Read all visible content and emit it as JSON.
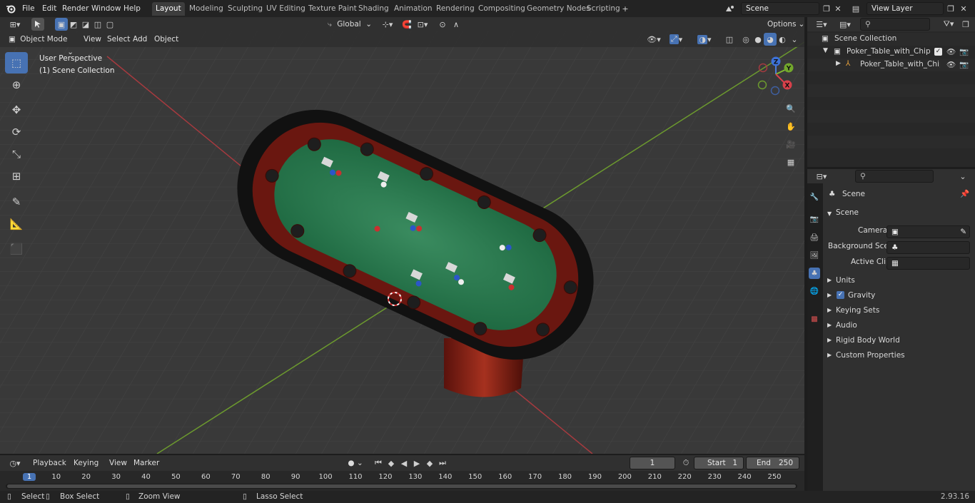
{
  "menu": {
    "file": "File",
    "edit": "Edit",
    "render": "Render",
    "window": "Window",
    "help": "Help"
  },
  "workspaces": [
    "Layout",
    "Modeling",
    "Sculpting",
    "UV Editing",
    "Texture Paint",
    "Shading",
    "Animation",
    "Rendering",
    "Compositing",
    "Geometry Nodes",
    "Scripting"
  ],
  "active_workspace": "Layout",
  "scene": {
    "name": "Scene"
  },
  "view_layer": {
    "name": "View Layer"
  },
  "header": {
    "transform": "Global",
    "options": "Options",
    "mode": "Object Mode",
    "view": "View",
    "select": "Select",
    "add": "Add",
    "object": "Object"
  },
  "viewport": {
    "perspective": "User Perspective",
    "collection": "(1) Scene Collection"
  },
  "gizmo": {
    "z": "Z",
    "y": "Y",
    "x": "X"
  },
  "outliner": {
    "root": "Scene Collection",
    "items": [
      {
        "label": "Poker_Table_with_Chips_and_"
      },
      {
        "label": "Poker_Table_with_Chips_"
      }
    ],
    "search_placeholder": ""
  },
  "properties": {
    "context": "Scene",
    "panel": "Scene",
    "camera_label": "Camera",
    "bg_label": "Background Scene",
    "clip_label": "Active Clip",
    "sections": [
      "Units",
      "Gravity",
      "Keying Sets",
      "Audio",
      "Rigid Body World",
      "Custom Properties"
    ]
  },
  "timeline": {
    "playback": "Playback",
    "keying": "Keying",
    "view": "View",
    "marker": "Marker",
    "current_frame": "1",
    "start_label": "Start",
    "start": "1",
    "end_label": "End",
    "end": "250",
    "ticks": [
      "1",
      "10",
      "20",
      "30",
      "40",
      "50",
      "60",
      "70",
      "80",
      "90",
      "100",
      "110",
      "120",
      "130",
      "140",
      "150",
      "160",
      "170",
      "180",
      "190",
      "200",
      "210",
      "220",
      "230",
      "240",
      "250"
    ]
  },
  "status": {
    "select": "Select",
    "box_select": "Box Select",
    "zoom": "Zoom View",
    "lasso": "Lasso Select",
    "version": "2.93.16"
  },
  "colors": {
    "accent": "#4772b3",
    "felt": "#2c7a52",
    "wood": "#6e1810",
    "rail": "#141414",
    "x_axis": "#d9414c",
    "y_axis": "#83b832"
  }
}
